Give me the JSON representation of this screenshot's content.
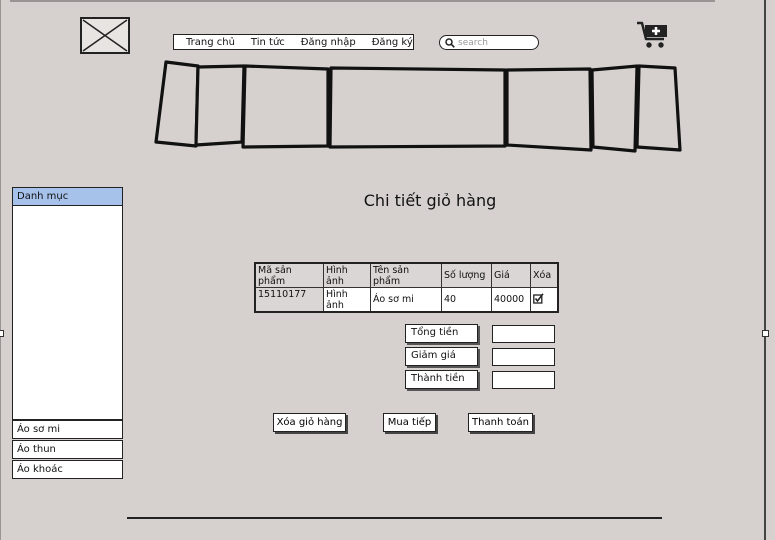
{
  "nav": {
    "items": [
      "Trang chủ",
      "Tin tức",
      "Đăng nhập",
      "Đăng ký"
    ]
  },
  "search": {
    "placeholder": "search"
  },
  "sidebar": {
    "header": "Danh mục",
    "items": [
      "Áo sơ mi",
      "Áo thun",
      "Áo khoác"
    ]
  },
  "page": {
    "title": "Chi tiết giỏ hàng"
  },
  "cart_table": {
    "columns": [
      "Mã sản phẩm",
      "Hình ảnh",
      "Tên sản phẩm",
      "Số lượng",
      "Giá",
      "Xóa"
    ],
    "rows": [
      {
        "code": "15110177",
        "image": "Hình ảnh",
        "name": "Áo sơ mi",
        "quantity": "40",
        "price": "40000",
        "delete_checked": true
      }
    ]
  },
  "summary": {
    "total_label": "Tổng tiền",
    "discount_label": "Giảm giá",
    "final_label": "Thành tiền"
  },
  "buttons": {
    "clear_cart": "Xóa giỏ hàng",
    "continue_shopping": "Mua tiếp",
    "checkout": "Thanh toán"
  },
  "colors": {
    "background": "#d6d1cf",
    "sidebar_header": "#a6c2ea"
  }
}
